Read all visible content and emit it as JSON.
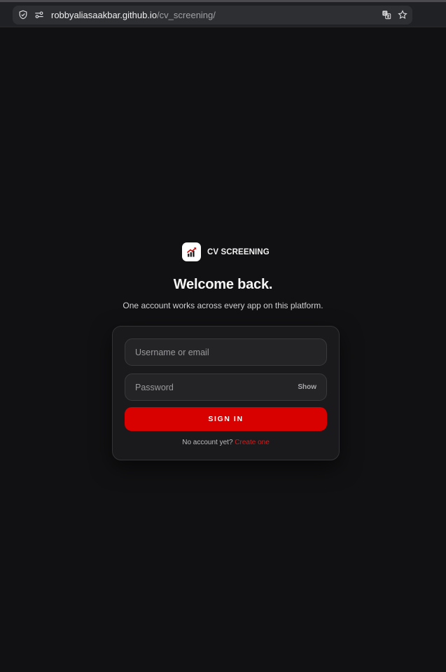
{
  "browser": {
    "url_host": "robbyaliasaakbar.github.io",
    "url_path": "/cv_screening/",
    "icons": [
      "shield-icon",
      "site-settings-icon",
      "translate-icon",
      "star-icon"
    ]
  },
  "brand": {
    "name": "CV SCREENING",
    "logo_icon": "chart-growth-icon",
    "accent_color": "#d90000"
  },
  "login": {
    "heading": "Welcome back.",
    "subheading": "One account works across every app on this platform.",
    "username_placeholder": "Username or email",
    "password_placeholder": "Password",
    "show_label": "Show",
    "signin_label": "SIGN IN",
    "no_account_text": "No account yet?",
    "create_label": "Create one"
  },
  "colors": {
    "background": "#111113",
    "card": "#1a1a1c",
    "button": "#d90000",
    "link": "#cc1f1f"
  }
}
